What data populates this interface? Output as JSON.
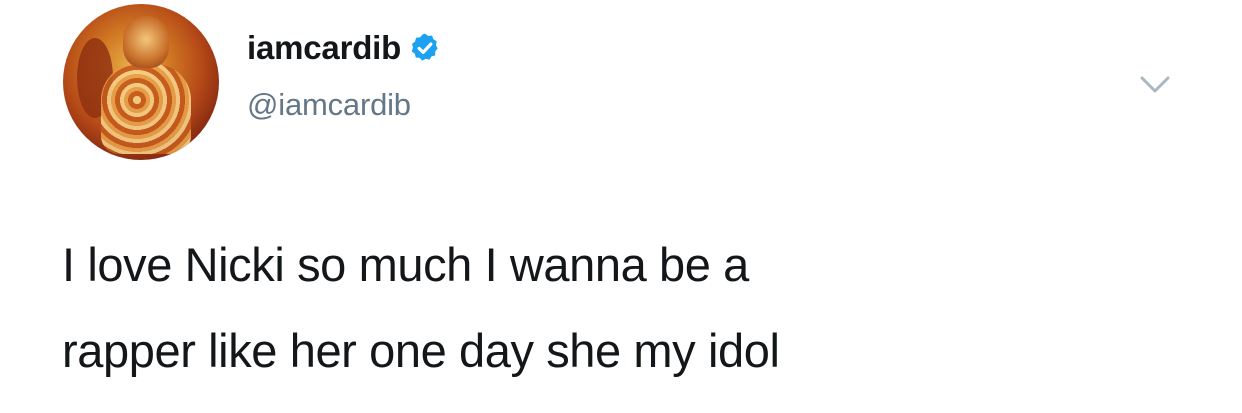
{
  "tweet": {
    "display_name": "iamcardib",
    "handle": "@iamcardib",
    "verified": true,
    "text_line_1": "I love Nicki so much I wanna be a",
    "text_line_2": "rapper like her one day she my idol"
  },
  "icons": {
    "verified": "verified-badge-icon",
    "menu": "chevron-down-icon"
  },
  "colors": {
    "text": "#14171a",
    "secondary_text": "#657786",
    "verified_blue": "#1da1f2",
    "chevron": "#aab8c2"
  }
}
